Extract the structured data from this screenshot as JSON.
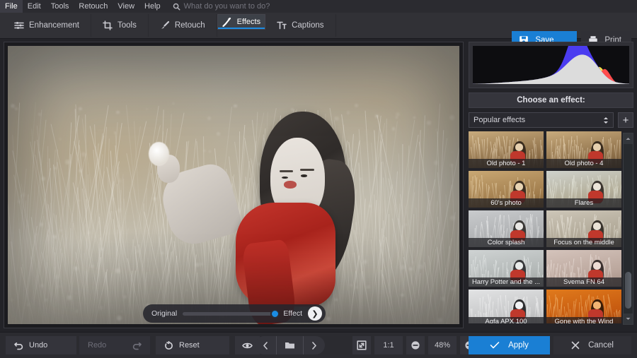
{
  "app": {
    "accent": "#1a7fd4",
    "panel_bg": "#2b2b30",
    "tabbar_bg": "#313136"
  },
  "menubar": {
    "items": [
      {
        "label": "File",
        "active": true
      },
      {
        "label": "Edit",
        "active": false
      },
      {
        "label": "Tools",
        "active": false
      },
      {
        "label": "Retouch",
        "active": false
      },
      {
        "label": "View",
        "active": false
      },
      {
        "label": "Help",
        "active": false
      }
    ],
    "search_placeholder": "What do you want to do?"
  },
  "tabs": [
    {
      "label": "Enhancement",
      "icon": "sliders-icon",
      "selected": false
    },
    {
      "label": "Tools",
      "icon": "crop-icon",
      "selected": false
    },
    {
      "label": "Retouch",
      "icon": "brush-icon",
      "selected": false
    },
    {
      "label": "Effects",
      "icon": "magic-wand-icon",
      "selected": true
    },
    {
      "label": "Captions",
      "icon": "text-icon",
      "selected": false
    }
  ],
  "actions": {
    "save_label": "Save",
    "print_label": "Print"
  },
  "compare": {
    "original_label": "Original",
    "effect_label": "Effect",
    "value": 100
  },
  "right_panel": {
    "section_title": "Choose an effect:",
    "category_selected": "Popular effects",
    "add_button": "+",
    "effects": [
      {
        "label": "Old photo - 1",
        "style": "sepia"
      },
      {
        "label": "Old photo - 4",
        "style": "sepia"
      },
      {
        "label": "60's photo",
        "style": "warm"
      },
      {
        "label": "Flares",
        "style": "flare"
      },
      {
        "label": "Color splash",
        "style": "gray"
      },
      {
        "label": "Focus on the middle",
        "style": "neutral"
      },
      {
        "label": "Harry Potter and the ...",
        "style": "cool"
      },
      {
        "label": "Svema FN 64",
        "style": "pink"
      },
      {
        "label": "Agfa APX 100",
        "style": "bw"
      },
      {
        "label": "Gone with the Wind",
        "style": "orange"
      }
    ]
  },
  "bottom_bar": {
    "undo_label": "Undo",
    "redo_label": "Redo",
    "redo_enabled": false,
    "reset_label": "Reset",
    "preview_icon": "eye-icon",
    "compare_icon": "split-view-icon",
    "prev_icon": "chevron-left-icon",
    "folder_icon": "folder-icon",
    "next_icon": "chevron-right-icon",
    "fit_icon": "fit-to-screen-icon",
    "actual_size_label": "1:1",
    "zoom_out_icon": "minus-circle-icon",
    "zoom_level": "48%",
    "zoom_in_icon": "plus-circle-icon",
    "apply_label": "Apply",
    "cancel_label": "Cancel"
  }
}
